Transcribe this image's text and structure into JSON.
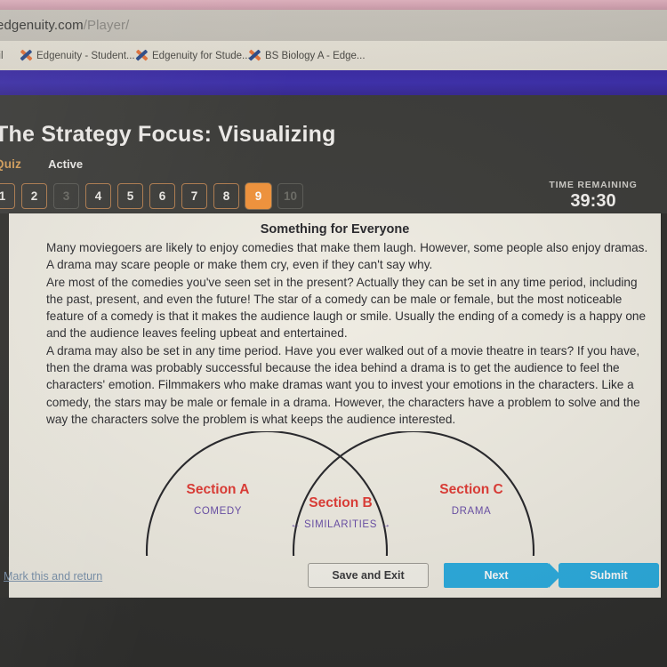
{
  "browser": {
    "url_domain": "edgenuity.com",
    "url_path": "/Player/",
    "bookmarks": [
      {
        "label": "ail",
        "icon": "edgenuity-x-icon"
      },
      {
        "label": "Edgenuity - Student...",
        "icon": "edgenuity-x-icon"
      },
      {
        "label": "Edgenuity for Stude...",
        "icon": "edgenuity-x-icon"
      },
      {
        "label": "BS Biology A - Edge...",
        "icon": "edgenuity-x-icon"
      }
    ]
  },
  "header": {
    "title": "The Strategy Focus: Visualizing",
    "activity_type": "Quiz",
    "activity_state": "Active",
    "timer_label": "TIME REMAINING",
    "timer_value": "39:30",
    "question_numbers": [
      {
        "label": "1",
        "state": "normal"
      },
      {
        "label": "2",
        "state": "normal"
      },
      {
        "label": "3",
        "state": "dim"
      },
      {
        "label": "4",
        "state": "normal"
      },
      {
        "label": "5",
        "state": "normal"
      },
      {
        "label": "6",
        "state": "normal"
      },
      {
        "label": "7",
        "state": "normal"
      },
      {
        "label": "8",
        "state": "normal"
      },
      {
        "label": "9",
        "state": "active"
      },
      {
        "label": "10",
        "state": "dim"
      }
    ]
  },
  "passage": {
    "title": "Something for Everyone",
    "paragraphs": [
      "Many moviegoers are likely to enjoy comedies that make them laugh.  However, some people also enjoy dramas.  A drama may scare people or make them cry, even if they can't say why.",
      "Are most of the comedies you've seen set in the present?  Actually they can be set in any time period, including the past, present, and even the future!  The star of a comedy can be male or female, but the most noticeable feature of a comedy is that it makes the audience laugh or smile.  Usually the ending of a comedy is a happy one and the audience leaves feeling upbeat and entertained.",
      "A drama may also be set in any time period.  Have you ever walked out of a movie theatre in tears?  If you have, then the drama was probably successful because the idea behind a drama is to get the audience to feel the characters' emotion.  Filmmakers who make dramas want you to invest your emotions in the characters.  Like a comedy, the stars may be male or female in a drama.  However, the characters have a problem to solve and the way the characters solve the problem is what keeps the audience interested."
    ]
  },
  "venn": {
    "left": {
      "name": "Section A",
      "sub": "COMEDY"
    },
    "center": {
      "name": "Section B",
      "sub": "← SIMILARITIES →"
    },
    "right": {
      "name": "Section C",
      "sub": "DRAMA"
    }
  },
  "footer": {
    "mark_link": "Mark this and return",
    "save_label": "Save and Exit",
    "next_label": "Next",
    "submit_label": "Submit"
  },
  "colors": {
    "accent_orange": "#f2933a",
    "band_purple": "#3d2fae",
    "button_blue": "#2badE0",
    "section_red": "#e03a34",
    "section_purple": "#6a4fa8",
    "link_blue": "#7b93ad"
  }
}
